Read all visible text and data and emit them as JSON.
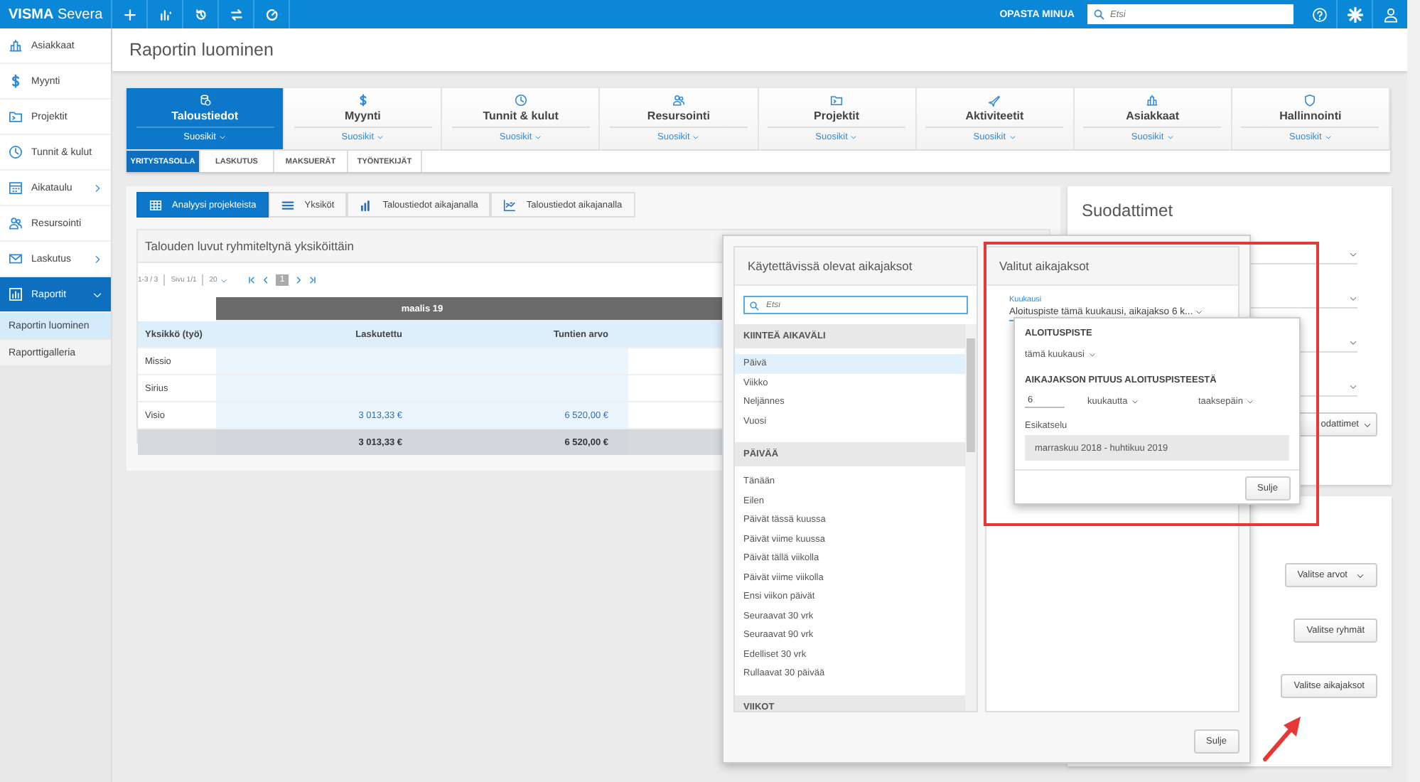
{
  "topbar": {
    "brand": "VISMA",
    "product": "Severa",
    "guide_link": "OPASTA MINUA",
    "search": {
      "placeholder": "Etsi"
    }
  },
  "sidebar": {
    "items": [
      {
        "label": "Asiakkaat",
        "kind": "link",
        "selected": false
      },
      {
        "label": "Myynti",
        "kind": "link",
        "selected": false
      },
      {
        "label": "Projektit",
        "kind": "link",
        "selected": false
      },
      {
        "label": "Tunnit & kulut",
        "kind": "link",
        "selected": false
      },
      {
        "label": "Aikataulu",
        "kind": "group",
        "selected": false,
        "expanded": false
      },
      {
        "label": "Resursointi",
        "kind": "link",
        "selected": false
      },
      {
        "label": "Laskutus",
        "kind": "group",
        "selected": false,
        "expanded": false
      },
      {
        "label": "Raportit",
        "kind": "group",
        "selected": true,
        "expanded": true,
        "children": [
          {
            "label": "Raportin luominen",
            "selected": true
          },
          {
            "label": "Raporttigalleria",
            "selected": false
          }
        ]
      }
    ]
  },
  "page_title": "Raportin luominen",
  "modules": [
    {
      "label": "Taloustiedot",
      "favorites": "Suosikit",
      "selected": true
    },
    {
      "label": "Myynti",
      "favorites": "Suosikit",
      "selected": false
    },
    {
      "label": "Tunnit & kulut",
      "favorites": "Suosikit",
      "selected": false
    },
    {
      "label": "Resursointi",
      "favorites": "Suosikit",
      "selected": false
    },
    {
      "label": "Projektit",
      "favorites": "Suosikit",
      "selected": false
    },
    {
      "label": "Aktiviteetit",
      "favorites": "Suosikit",
      "selected": false
    },
    {
      "label": "Asiakkaat",
      "favorites": "Suosikit",
      "selected": false
    },
    {
      "label": "Hallinnointi",
      "favorites": "Suosikit",
      "selected": false
    }
  ],
  "subtabs": [
    {
      "label": "YRITYSTASOLLA",
      "selected": true
    },
    {
      "label": "LASKUTUS",
      "selected": false
    },
    {
      "label": "MAKSUERÄT",
      "selected": false
    },
    {
      "label": "TYÖNTEKIJÄT",
      "selected": false
    }
  ],
  "views": [
    {
      "label": "Analyysi projekteista",
      "selected": true
    },
    {
      "label": "Yksiköt",
      "selected": false
    },
    {
      "label": "Taloustiedot aikajanalla",
      "selected": false
    },
    {
      "label": "Taloustiedot aikajanalla",
      "selected": false
    }
  ],
  "report": {
    "title": "Talouden luvut ryhmiteltynä yksiköittäin",
    "pager": {
      "range": "1-3 / 3",
      "page": "Sivu 1/1",
      "page_size": "20",
      "current": "1"
    },
    "table": {
      "group_header": "maalis 19",
      "columns": [
        "Yksikkö (työ)",
        "Laskutettu",
        "Tuntien arvo"
      ],
      "rows": [
        {
          "unit": "Missio"
        },
        {
          "unit": "Sirius"
        },
        {
          "unit": "Visio",
          "invoiced": "3 013,33 €",
          "hour_value": "6 520,00 €"
        }
      ],
      "total": {
        "invoiced": "3 013,33 €",
        "hour_value": "6 520,00 €"
      }
    }
  },
  "filters": {
    "title": "Suodattimet",
    "button": "odattimet"
  },
  "actions": [
    {
      "label": "Valitse arvot",
      "kind": "dropdown"
    },
    {
      "label": "Valitse ryhmät",
      "kind": "button"
    },
    {
      "label": "Valitse aikajaksot",
      "kind": "button"
    }
  ],
  "dialog": {
    "available": {
      "title": "Käytettävissä olevat aikajaksot",
      "search": {
        "placeholder": "Etsi"
      },
      "groups": [
        {
          "heading": "KIINTEÄ AIKAVÄLI",
          "items": [
            {
              "label": "Päivä",
              "selected": true
            },
            {
              "label": "Viikko",
              "selected": false
            },
            {
              "label": "Neljännes",
              "selected": false
            },
            {
              "label": "Vuosi",
              "selected": false
            }
          ]
        },
        {
          "heading": "PÄIVÄÄ",
          "items": [
            {
              "label": "Tänään",
              "selected": false
            },
            {
              "label": "Eilen",
              "selected": false
            },
            {
              "label": "Päivät tässä kuussa",
              "selected": false
            },
            {
              "label": "Päivät viime kuussa",
              "selected": false
            },
            {
              "label": "Päivät tällä viikolla",
              "selected": false
            },
            {
              "label": "Päivät viime viikolla",
              "selected": false
            },
            {
              "label": "Ensi viikon päivät",
              "selected": false
            },
            {
              "label": "Seuraavat 30 vrk",
              "selected": false
            },
            {
              "label": "Seuraavat 90 vrk",
              "selected": false
            },
            {
              "label": "Edelliset 30 vrk",
              "selected": false
            },
            {
              "label": "Rullaavat 30 päivää",
              "selected": false
            }
          ]
        },
        {
          "heading": "VIIKOT"
        }
      ]
    },
    "chosen": {
      "title": "Valitut aikajaksot",
      "field": {
        "label": "Kuukausi",
        "value": "Aloituspiste tämä kuukausi, aikajakso 6 k..."
      }
    },
    "close": "Sulje"
  },
  "popover": {
    "start_heading": "ALOITUSPISTE",
    "start_value": "tämä kuukausi",
    "length_heading": "AIKAJAKSON PITUUS ALOITUSPISTEESTÄ",
    "length": "6",
    "unit": "kuukautta",
    "direction": "taaksepäin",
    "preview_label": "Esikatselu",
    "preview": "marraskuu 2018 - huhtikuu 2019",
    "close": "Sulje"
  }
}
